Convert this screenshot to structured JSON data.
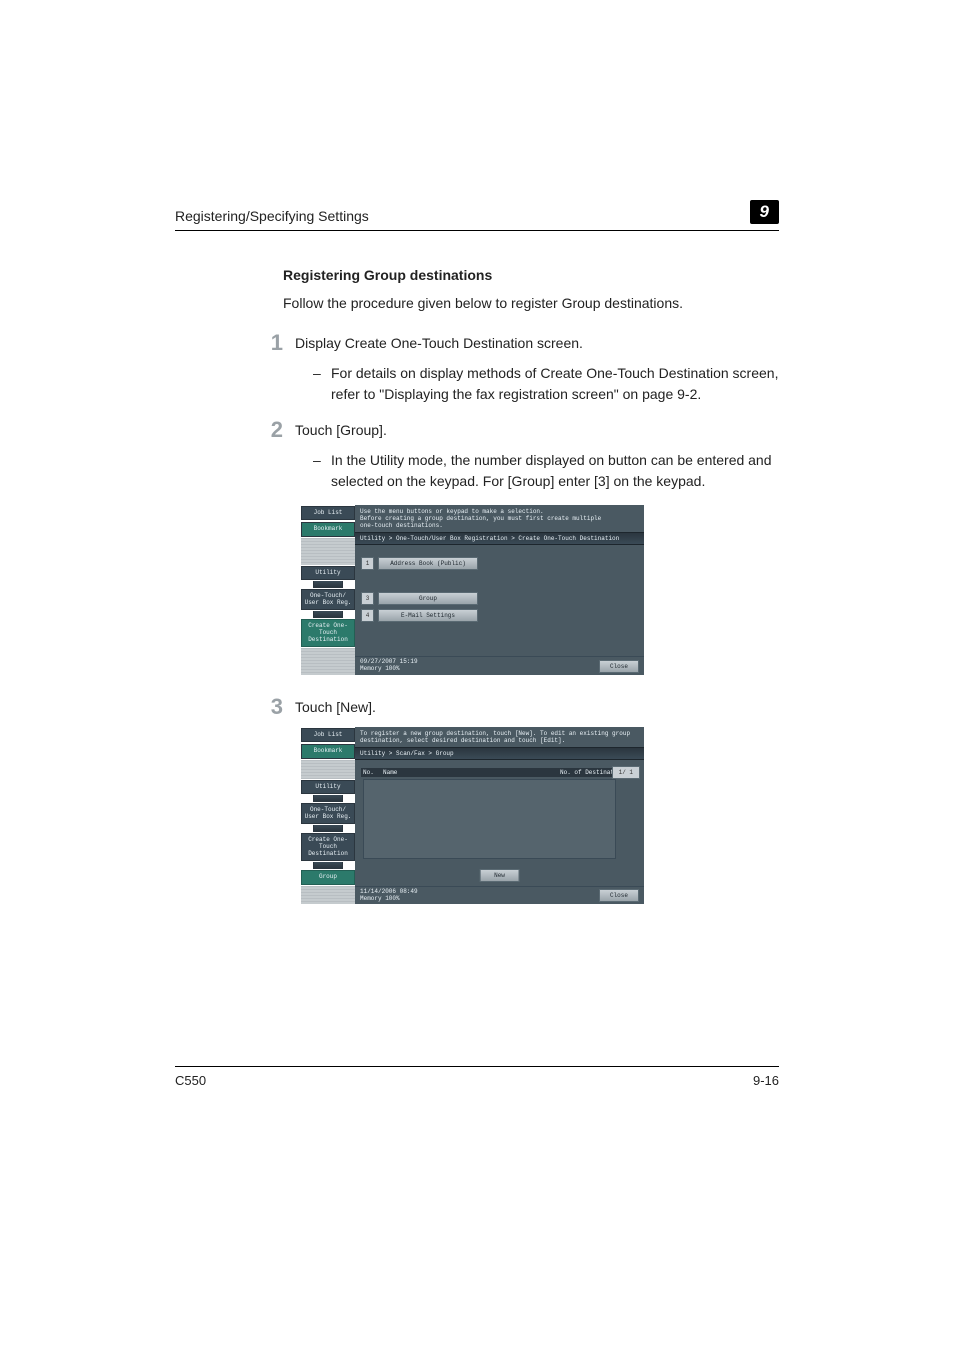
{
  "header": {
    "section": "Registering/Specifying Settings",
    "chapter_number": "9"
  },
  "h2": "Registering Group destinations",
  "intro": "Follow the procedure given below to register Group destinations.",
  "step1": {
    "num": "1",
    "text": "Display Create One-Touch Destination screen.",
    "bullet": "For details on display methods of Create One-Touch Destination screen, refer to \"Displaying the fax registration screen\" on page 9-2."
  },
  "step2": {
    "num": "2",
    "text": "Touch [Group].",
    "bullet": "In the Utility mode, the number displayed on button can be entered and selected on the keypad. For [Group] enter [3] on the keypad."
  },
  "step3": {
    "num": "3",
    "text": "Touch [New]."
  },
  "panel1": {
    "sb": {
      "job": "Job List",
      "bm": "Bookmark",
      "util": "Utility",
      "ot": "One-Touch/\nUser Box Reg.",
      "cd": "Create One-Touch\nDestination"
    },
    "msg": "Use the menu buttons or keypad to make a selection.\nBefore creating a group destination, you must first create multiple\none-touch destinations.",
    "crumb": "Utility > One-Touch/User Box Registration > Create One-Touch Destination",
    "b1": {
      "n": "1",
      "l": "Address Book (Public)"
    },
    "b3": {
      "n": "3",
      "l": "Group"
    },
    "b4": {
      "n": "4",
      "l": "E-Mail Settings"
    },
    "foot": {
      "dt": "09/27/2007   15:19\nMemory       100%",
      "close": "Close"
    }
  },
  "panel2": {
    "sb": {
      "job": "Job List",
      "bm": "Bookmark",
      "util": "Utility",
      "ot": "One-Touch/\nUser Box Reg.",
      "cd": "Create One-Touch\nDestination",
      "grp": "Group"
    },
    "msg": "To register a new group destination, touch [New]. To edit an existing group\ndestination, select desired destination and touch [Edit].",
    "crumb": "Utility > Scan/Fax > Group",
    "head": {
      "c1": "No.",
      "c2": "Name",
      "c3": "No. of Destinations"
    },
    "pager": "1/   1",
    "newbtn": "New",
    "foot": {
      "dt": "11/14/2006   08:49\nMemory       100%",
      "close": "Close"
    }
  },
  "footer": {
    "model": "C550",
    "page": "9-16"
  }
}
